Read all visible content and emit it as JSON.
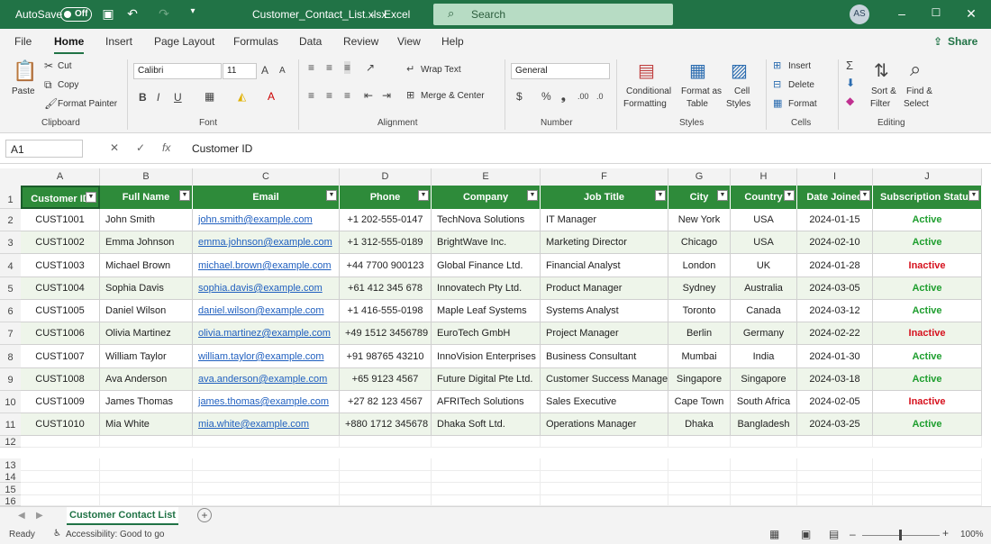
{
  "titlebar": {
    "autosave_label": "AutoSave",
    "autosave_state": "Off",
    "file_name": "Customer_Contact_List.xlsx",
    "app_name": "Excel",
    "search_placeholder": "Search",
    "avatar_initials": "AS"
  },
  "menu": [
    "File",
    "Home",
    "Insert",
    "Page Layout",
    "Formulas",
    "Data",
    "Review",
    "View",
    "Help"
  ],
  "share_label": "Share",
  "ribbon": {
    "clipboard": {
      "paste": "Paste",
      "cut": "Cut",
      "copy": "Copy",
      "format_painter": "Format Painter",
      "label": "Clipboard"
    },
    "font": {
      "name": "Calibri",
      "size": "11",
      "label": "Font"
    },
    "alignment": {
      "wrap": "Wrap Text",
      "merge": "Merge & Center",
      "label": "Alignment"
    },
    "number": {
      "format": "General",
      "label": "Number"
    },
    "styles": {
      "cond1": "Conditional",
      "cond2": "Formatting",
      "fmt1": "Format as",
      "fmt2": "Table",
      "cell1": "Cell",
      "cell2": "Styles",
      "label": "Styles"
    },
    "cells": {
      "insert": "Insert",
      "delete": "Delete",
      "format": "Format",
      "label": "Cells"
    },
    "editing": {
      "sort1": "Sort &",
      "sort2": "Filter",
      "find1": "Find &",
      "find2": "Select",
      "label": "Editing"
    }
  },
  "formula_bar": {
    "name_box": "A1",
    "value": "Customer ID"
  },
  "columns": [
    "A",
    "B",
    "C",
    "D",
    "E",
    "F",
    "G",
    "H",
    "I",
    "J"
  ],
  "rows": [
    "1",
    "2",
    "3",
    "4",
    "5",
    "6",
    "7",
    "8",
    "9",
    "10",
    "11",
    "12",
    "13",
    "14",
    "15",
    "16"
  ],
  "table": {
    "headers": [
      "Customer ID",
      "Full Name",
      "Email",
      "Phone",
      "Company",
      "Job Title",
      "City",
      "Country",
      "Date Joined",
      "Subscription Status"
    ],
    "rows": [
      [
        "CUST1001",
        "John Smith",
        "john.smith@example.com",
        "+1 202-555-0147",
        "TechNova Solutions",
        "IT Manager",
        "New York",
        "USA",
        "2024-01-15",
        "Active"
      ],
      [
        "CUST1002",
        "Emma Johnson",
        "emma.johnson@example.com",
        "+1 312-555-0189",
        "BrightWave Inc.",
        "Marketing Director",
        "Chicago",
        "USA",
        "2024-02-10",
        "Active"
      ],
      [
        "CUST1003",
        "Michael Brown",
        "michael.brown@example.com",
        "+44 7700 900123",
        "Global Finance Ltd.",
        "Financial Analyst",
        "London",
        "UK",
        "2024-01-28",
        "Inactive"
      ],
      [
        "CUST1004",
        "Sophia Davis",
        "sophia.davis@example.com",
        "+61 412 345 678",
        "Innovatech Pty Ltd.",
        "Product Manager",
        "Sydney",
        "Australia",
        "2024-03-05",
        "Active"
      ],
      [
        "CUST1005",
        "Daniel Wilson",
        "daniel.wilson@example.com",
        "+1 416-555-0198",
        "Maple Leaf Systems",
        "Systems Analyst",
        "Toronto",
        "Canada",
        "2024-03-12",
        "Active"
      ],
      [
        "CUST1006",
        "Olivia Martinez",
        "olivia.martinez@example.com",
        "+49 1512 3456789",
        "EuroTech GmbH",
        "Project Manager",
        "Berlin",
        "Germany",
        "2024-02-22",
        "Inactive"
      ],
      [
        "CUST1007",
        "William Taylor",
        "william.taylor@example.com",
        "+91 98765 43210",
        "InnoVision Enterprises",
        "Business Consultant",
        "Mumbai",
        "India",
        "2024-01-30",
        "Active"
      ],
      [
        "CUST1008",
        "Ava Anderson",
        "ava.anderson@example.com",
        "+65 9123 4567",
        "Future Digital Pte Ltd.",
        "Customer Success Manager",
        "Singapore",
        "Singapore",
        "2024-03-18",
        "Active"
      ],
      [
        "CUST1009",
        "James Thomas",
        "james.thomas@example.com",
        "+27 82 123 4567",
        "AFRITech Solutions",
        "Sales Executive",
        "Cape Town",
        "South Africa",
        "2024-02-05",
        "Inactive"
      ],
      [
        "CUST1010",
        "Mia White",
        "mia.white@example.com",
        "+880 1712 345678",
        "Dhaka Soft Ltd.",
        "Operations Manager",
        "Dhaka",
        "Bangladesh",
        "2024-03-25",
        "Active"
      ]
    ]
  },
  "sheet_tab": "Customer Contact List",
  "status": {
    "ready": "Ready",
    "accessibility": "Accessibility: Good to go",
    "zoom": "100%"
  }
}
